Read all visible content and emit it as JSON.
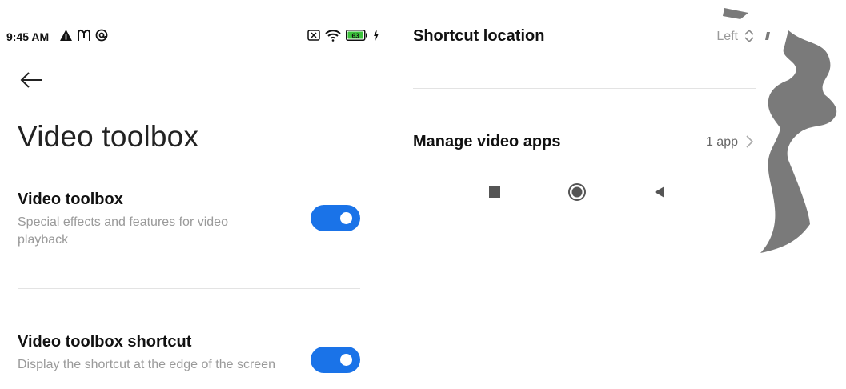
{
  "status_bar": {
    "time": "9:45 AM",
    "left_icons": [
      "warning-icon",
      "m-logo-icon",
      "at-circle-icon"
    ],
    "right_icons": [
      "sim-x-icon",
      "wifi-icon",
      "battery-icon",
      "charging-icon"
    ],
    "battery_level": "63"
  },
  "header": {
    "back_icon": "back-arrow-icon",
    "title": "Video toolbox"
  },
  "settings": [
    {
      "title": "Video toolbox",
      "description": "Special effects and features for video playback",
      "enabled": true
    },
    {
      "title": "Video toolbox shortcut",
      "description": "Display the shortcut at the edge of the screen",
      "enabled": true
    }
  ],
  "options": {
    "shortcut_location": {
      "title": "Shortcut location",
      "value": "Left"
    },
    "manage_video_apps": {
      "title": "Manage video apps",
      "value": "1 app"
    }
  },
  "nav_bar": {
    "buttons": [
      "recents-icon",
      "home-icon",
      "back-triangle-icon"
    ]
  },
  "colors": {
    "accent": "#1a73e8",
    "secondary_text": "#9a9a9a",
    "battery_fill": "#3cc33c",
    "decoration": "#7a7a7a"
  }
}
